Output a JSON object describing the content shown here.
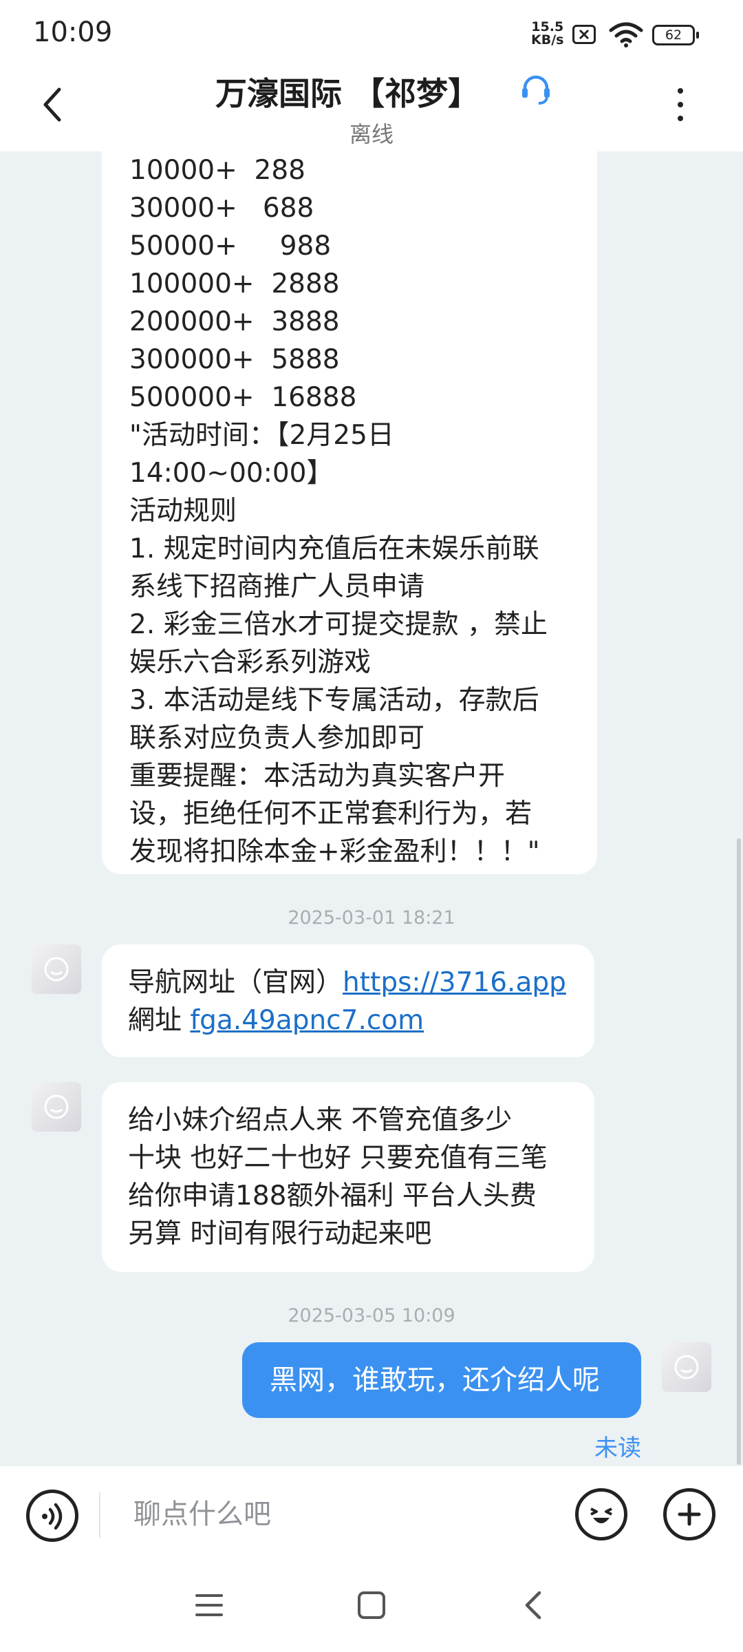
{
  "status_bar": {
    "time": "10:09",
    "net_speed_value": "15.5",
    "net_speed_unit": "KB/s",
    "battery": "62",
    "icons": [
      "no-sim-icon",
      "wifi-icon",
      "battery-icon"
    ]
  },
  "header": {
    "title": "万濠国际 【祁梦】",
    "status": "离线",
    "icons": [
      "back-arrow-icon",
      "headset-icon",
      "more-vertical-icon"
    ]
  },
  "messages": {
    "msg1_lines": [
      "10000+  288",
      "30000+   688",
      "50000+     988",
      "100000+  2888",
      "200000+  3888",
      "300000+  5888",
      "500000+  16888",
      "\"活动时间：【2月25日",
      "14:00~00:00】",
      "活动规则",
      "1. 规定时间内充值后在未娱乐前联",
      "系线下招商推广人员申请",
      "2. 彩金三倍水才可提交提款 ，禁止",
      "娱乐六合彩系列游戏",
      "3. 本活动是线下专属活动，存款后",
      "联系对应负责人参加即可",
      "重要提醒：本活动为真实客户开",
      "设，拒绝任何不正常套利行为，若",
      "发现将扣除本金+彩金盈利！！！\""
    ],
    "timestamp1": "2025-03-01 18:21",
    "msg2_prefix1": "导航网址（官网）",
    "msg2_link1": "https://3716.app",
    "msg2_prefix2": "網址 ",
    "msg2_link2": "fga.49apnc7.com",
    "msg3_lines": [
      "给小妹介绍点人来 不管充值多少",
      "十块 也好二十也好 只要充值有三笔",
      "给你申请188额外福利  平台人头费",
      "另算  时间有限行动起来吧"
    ],
    "timestamp2": "2025-03-05 10:09",
    "msg4": "黑网，谁敢玩，还介绍人呢",
    "read_status": "未读"
  },
  "input_bar": {
    "placeholder": "聊点什么吧",
    "icons": [
      "voice-icon",
      "emoji-icon",
      "plus-icon"
    ]
  },
  "nav_bar": {
    "icons": [
      "menu-icon",
      "home-square-icon",
      "back-triangle-icon"
    ]
  },
  "colors": {
    "accent": "#3b91f1",
    "link": "#1b6fc7",
    "chat_background": "#ecf1f4"
  }
}
